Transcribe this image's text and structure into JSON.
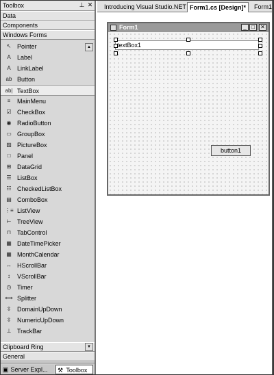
{
  "toolbox": {
    "title": "Toolbox",
    "pin_glyph": "⊥",
    "close_glyph": "✕",
    "categories_top": [
      "Data",
      "Components",
      "Windows Forms"
    ],
    "items": [
      {
        "label": "Pointer",
        "icon": "pointer-icon",
        "glyph": "↖"
      },
      {
        "label": "Label",
        "icon": "label-icon",
        "glyph": "A"
      },
      {
        "label": "LinkLabel",
        "icon": "linklabel-icon",
        "glyph": "A"
      },
      {
        "label": "Button",
        "icon": "button-icon",
        "glyph": "ab"
      },
      {
        "label": "TextBox",
        "icon": "textbox-icon",
        "glyph": "ab|",
        "selected": true
      },
      {
        "label": "MainMenu",
        "icon": "mainmenu-icon",
        "glyph": "≡"
      },
      {
        "label": "CheckBox",
        "icon": "checkbox-icon",
        "glyph": "☑"
      },
      {
        "label": "RadioButton",
        "icon": "radiobutton-icon",
        "glyph": "◉"
      },
      {
        "label": "GroupBox",
        "icon": "groupbox-icon",
        "glyph": "▭"
      },
      {
        "label": "PictureBox",
        "icon": "picturebox-icon",
        "glyph": "▨"
      },
      {
        "label": "Panel",
        "icon": "panel-icon",
        "glyph": "□"
      },
      {
        "label": "DataGrid",
        "icon": "datagrid-icon",
        "glyph": "⊞"
      },
      {
        "label": "ListBox",
        "icon": "listbox-icon",
        "glyph": "☰"
      },
      {
        "label": "CheckedListBox",
        "icon": "checkedlistbox-icon",
        "glyph": "☷"
      },
      {
        "label": "ComboBox",
        "icon": "combobox-icon",
        "glyph": "▤"
      },
      {
        "label": "ListView",
        "icon": "listview-icon",
        "glyph": "⋮≡"
      },
      {
        "label": "TreeView",
        "icon": "treeview-icon",
        "glyph": "⊢"
      },
      {
        "label": "TabControl",
        "icon": "tabcontrol-icon",
        "glyph": "⊓"
      },
      {
        "label": "DateTimePicker",
        "icon": "datetimepicker-icon",
        "glyph": "▦"
      },
      {
        "label": "MonthCalendar",
        "icon": "monthcalendar-icon",
        "glyph": "▦"
      },
      {
        "label": "HScrollBar",
        "icon": "hscrollbar-icon",
        "glyph": "↔"
      },
      {
        "label": "VScrollBar",
        "icon": "vscrollbar-icon",
        "glyph": "↕"
      },
      {
        "label": "Timer",
        "icon": "timer-icon",
        "glyph": "◷"
      },
      {
        "label": "Splitter",
        "icon": "splitter-icon",
        "glyph": "⟺"
      },
      {
        "label": "DomainUpDown",
        "icon": "domainupdown-icon",
        "glyph": "⇳"
      },
      {
        "label": "NumericUpDown",
        "icon": "numericupdown-icon",
        "glyph": "⇳"
      },
      {
        "label": "TrackBar",
        "icon": "trackbar-icon",
        "glyph": "⊥"
      }
    ],
    "category_clipboard": "Clipboard Ring",
    "category_general": "General",
    "bottom_tabs": {
      "server": "Server Expl...",
      "toolbox": "Toolbox"
    }
  },
  "editor": {
    "tabs": [
      "Introducing Visual Studio.NET",
      "Form1.cs [Design]*",
      "Form1."
    ],
    "active_tab_index": 1
  },
  "form": {
    "title": "Form1",
    "textbox_text": "textBox1",
    "button_text": "button1",
    "min_glyph": "_",
    "max_glyph": "□",
    "close_glyph": "✕"
  }
}
